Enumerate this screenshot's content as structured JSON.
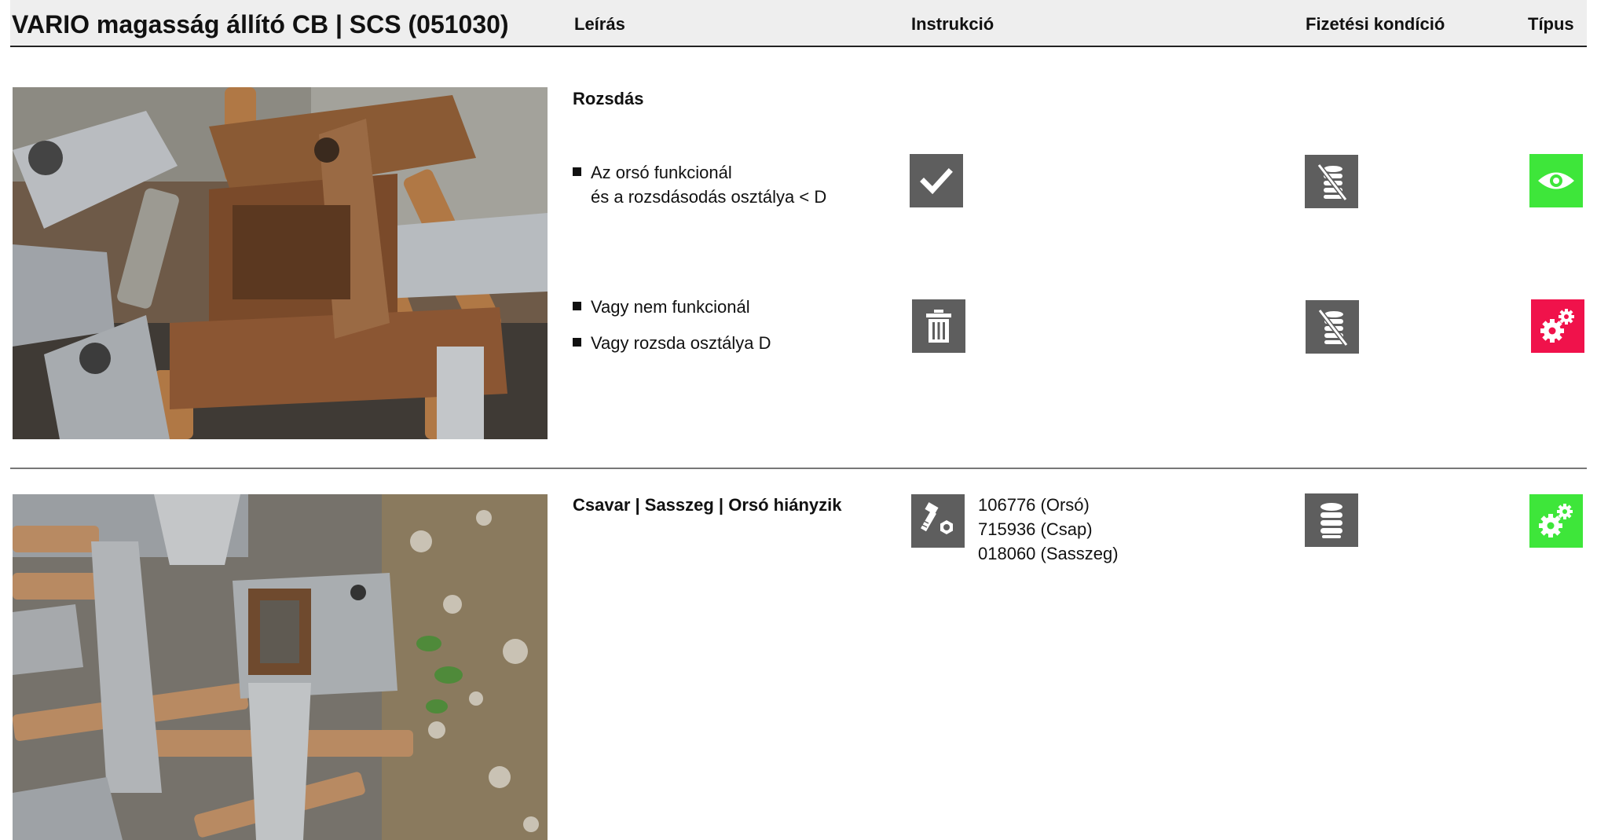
{
  "header": {
    "title": "VARIO magasság állító CB | SCS (051030)",
    "col_description": "Leírás",
    "col_instruction": "Instrukció",
    "col_payment": "Fizetési kondíció",
    "col_type": "Típus"
  },
  "section1": {
    "title": "Rozsdás",
    "row1": {
      "line1": "Az orsó funkcionál",
      "line2": "és a rozsdásodás osztálya < D",
      "instruction_icon": "checkmark-icon",
      "payment_icon": "no-payment-coins-icon",
      "type_icon": "eye-icon",
      "type_color": "#3ee63a"
    },
    "row2": {
      "line1": "Vagy nem funkcionál",
      "line2": "Vagy rozsda osztálya D",
      "instruction_icon": "trash-icon",
      "payment_icon": "no-payment-coins-icon",
      "type_icon": "gears-icon",
      "type_color": "#f0124b"
    }
  },
  "section2": {
    "title": "Csavar | Sasszeg | Orsó hiányzik",
    "parts": [
      "106776 (Orsó)",
      "715936 (Csap)",
      "018060 (Sasszeg)"
    ],
    "instruction_icon": "bolt-nut-icon",
    "payment_icon": "coins-icon",
    "type_icon": "gears-icon",
    "type_color": "#3ee63a"
  }
}
